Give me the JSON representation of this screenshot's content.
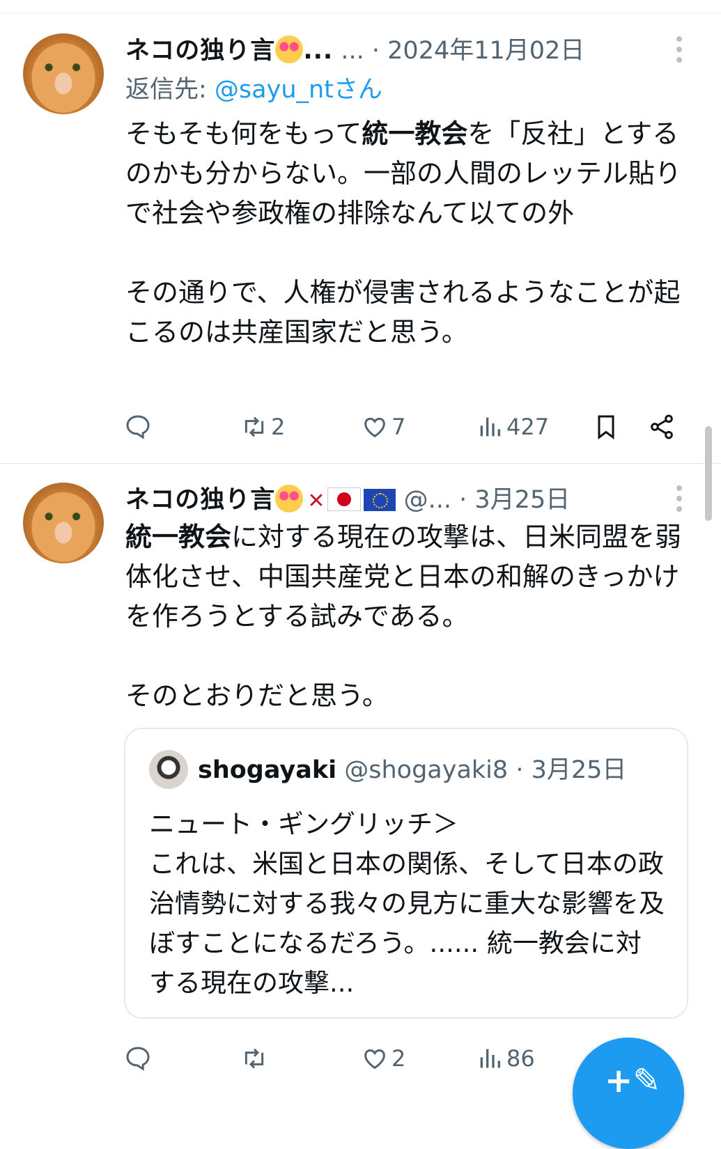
{
  "tweets": [
    {
      "display_name": "ネコの独り言",
      "name_suffix": "...",
      "handle": "...",
      "separator": "·",
      "timestamp": "2024年11月02日",
      "reply_prefix": "返信先: ",
      "reply_to": "@sayu_ntさん",
      "text_bold": "統一教会",
      "text_before": "そもそも何をもって",
      "text_after": "を「反社」とするのかも分からない。一部の人間のレッテル貼りで社会や参政権の排除なんて以ての外\n\nその通りで、人権が侵害されるようなことが起こるのは共産国家だと思う。",
      "stats": {
        "reposts": "2",
        "likes": "7",
        "views": "427"
      }
    },
    {
      "display_name": "ネコの独り言",
      "handle": "@...",
      "separator": "·",
      "timestamp": "3月25日",
      "text_bold": "統一教会",
      "text_after": "に対する現在の攻撃は、日米同盟を弱体化させ、中国共産党と日本の和解のきっかけを作ろうとする試みである。\n\nそのとおりだと思う。",
      "quote": {
        "display_name": "shogayaki",
        "handle": "@shogayaki8",
        "separator": "·",
        "timestamp": "3月25日",
        "text": "ニュート・ギングリッチ＞\nこれは、米国と日本の関係、そして日本の政治情勢に対する我々の見方に重大な影響を及ぼすことになるだろう。...... 統一教会に対する現在の攻撃..."
      },
      "stats": {
        "reposts": "",
        "likes": "2",
        "views": "86"
      }
    }
  ],
  "icons": [
    "avatar",
    "cat-emoji-icon",
    "japan-flag-icon",
    "eu-flag-icon",
    "reply-icon",
    "repost-icon",
    "like-icon",
    "views-icon",
    "bookmark-icon",
    "share-icon",
    "more-icon",
    "compose-icon"
  ],
  "colors": {
    "accent": "#1d9bf0",
    "secondary_text": "#536471",
    "primary_text": "#0f1419",
    "divider": "#eff3f4"
  }
}
